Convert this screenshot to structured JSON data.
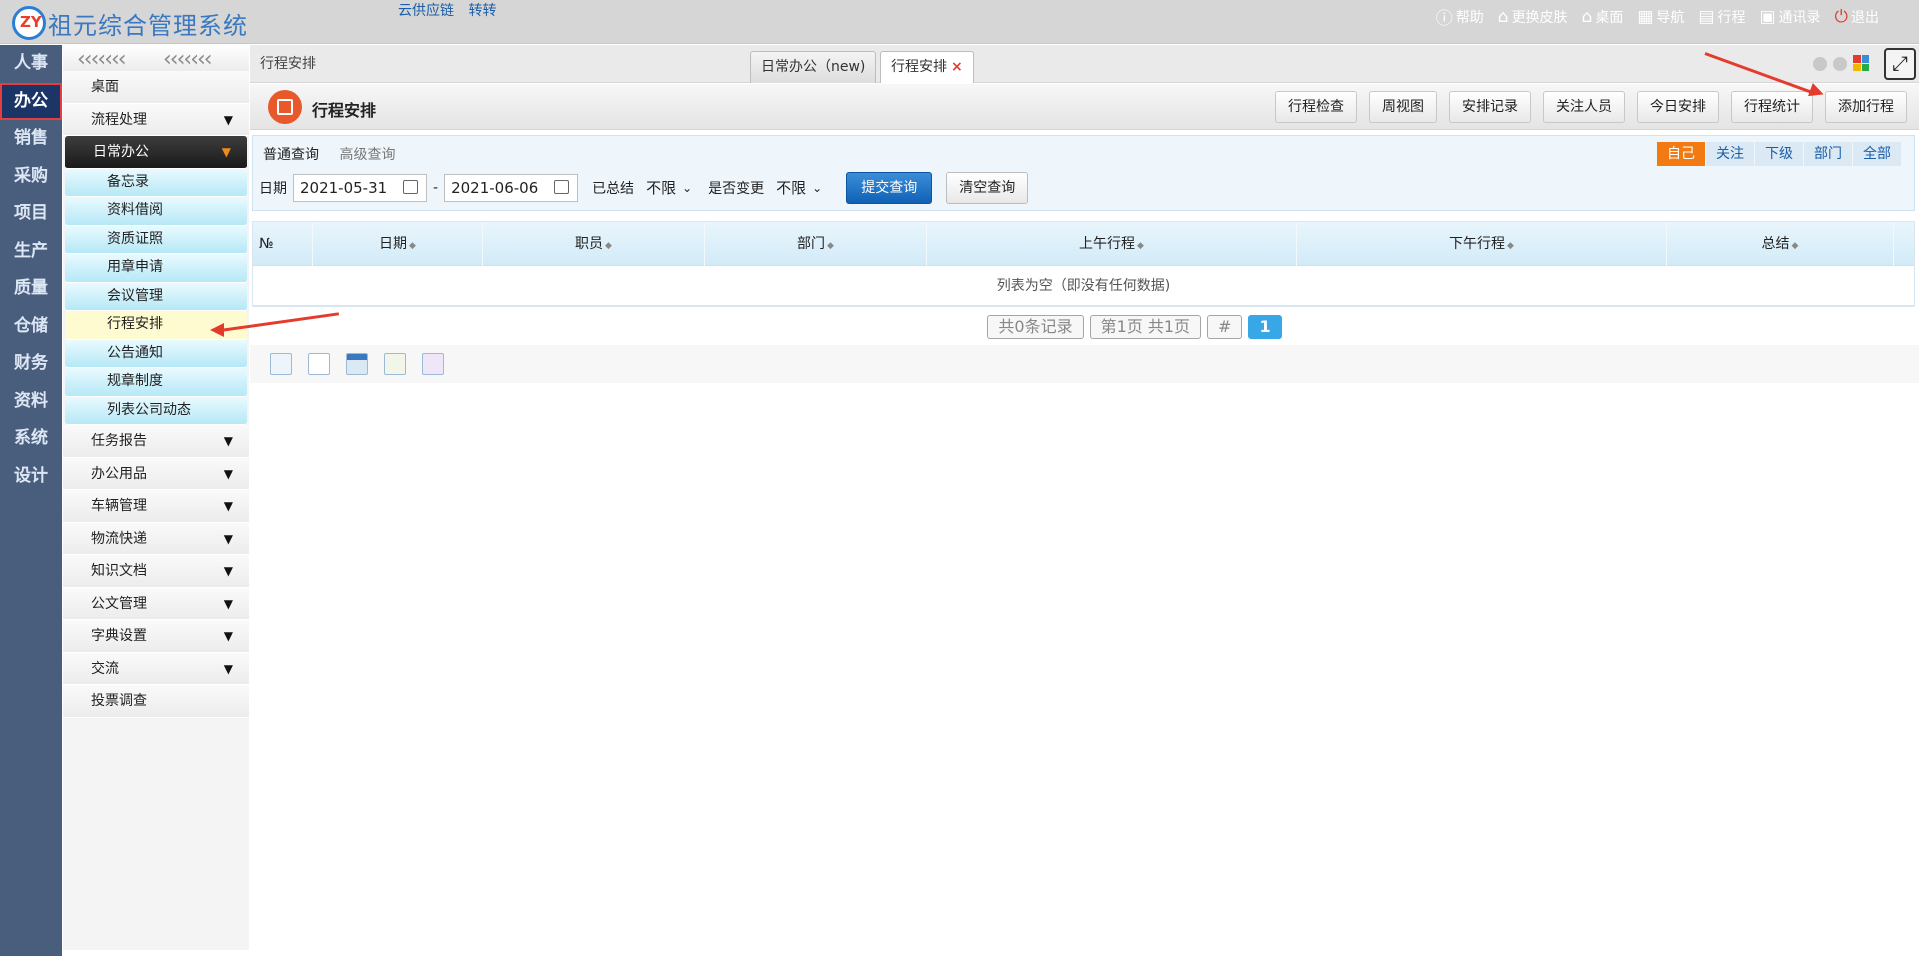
{
  "app": {
    "title": "祖元综合管理系统",
    "logo_text": "ZY",
    "top_links": [
      "云供应链",
      "转转"
    ],
    "top_menu": [
      {
        "label": "帮助",
        "icon": "help-icon"
      },
      {
        "label": "更换皮肤",
        "icon": "shirt-icon"
      },
      {
        "label": "桌面",
        "icon": "home-icon"
      },
      {
        "label": "导航",
        "icon": "grid-icon"
      },
      {
        "label": "行程",
        "icon": "calendar-icon"
      },
      {
        "label": "通讯录",
        "icon": "contact-icon"
      },
      {
        "label": "退出",
        "icon": "power-icon"
      }
    ]
  },
  "leftnav": [
    "人事",
    "办公",
    "销售",
    "采购",
    "项目",
    "生产",
    "质量",
    "仓储",
    "财务",
    "资料",
    "系统",
    "设计"
  ],
  "leftnav_active": "办公",
  "submenu": {
    "collapse_label": "<<",
    "items": [
      {
        "label": "桌面",
        "arrow": false
      },
      {
        "label": "流程处理",
        "arrow": true
      }
    ],
    "open_group": {
      "label": "日常办公",
      "children": [
        "备忘录",
        "资料借阅",
        "资质证照",
        "用章申请",
        "会议管理",
        "行程安排",
        "公告通知",
        "规章制度",
        "列表公司动态"
      ],
      "active": "行程安排"
    },
    "rest": [
      {
        "label": "任务报告",
        "arrow": true
      },
      {
        "label": "办公用品",
        "arrow": true
      },
      {
        "label": "车辆管理",
        "arrow": true
      },
      {
        "label": "物流快递",
        "arrow": true
      },
      {
        "label": "知识文档",
        "arrow": true
      },
      {
        "label": "公文管理",
        "arrow": true
      },
      {
        "label": "字典设置",
        "arrow": true
      },
      {
        "label": "交流",
        "arrow": true
      },
      {
        "label": "投票调查",
        "arrow": false
      }
    ]
  },
  "tabs": {
    "crumb": "行程安排",
    "items": [
      {
        "label": "日常办公（new)",
        "active": false
      },
      {
        "label": "行程安排",
        "active": true,
        "close": "×"
      }
    ]
  },
  "page": {
    "title": "行程安排",
    "buttons": [
      "行程检查",
      "周视图",
      "安排记录",
      "关注人员",
      "今日安排",
      "行程统计",
      "添加行程"
    ]
  },
  "query": {
    "tabs": [
      "普通查询",
      "高级查询"
    ],
    "scope": [
      "自己",
      "关注",
      "下级",
      "部门",
      "全部"
    ],
    "scope_active": "自己",
    "date_label": "日期",
    "date_from": "2021-05-31",
    "date_sep": "-",
    "date_to": "2021-06-06",
    "summary_label": "已总结",
    "summary_value": "不限",
    "changed_label": "是否变更",
    "changed_value": "不限",
    "submit": "提交查询",
    "clear": "清空查询"
  },
  "table": {
    "columns": [
      "№",
      "日期",
      "职员",
      "部门",
      "上午行程",
      "下午行程",
      "总结"
    ],
    "empty_text": "列表为空（即没有任何数据)"
  },
  "pager": {
    "total": "共0条记录",
    "pages": "第1页 共1页",
    "hash": "#",
    "current": "1"
  },
  "colors": {
    "nav_bg": "#495e7c",
    "accent_orange": "#f27a12",
    "primary_blue": "#1061b5",
    "annotation_red": "#e53b2c"
  }
}
